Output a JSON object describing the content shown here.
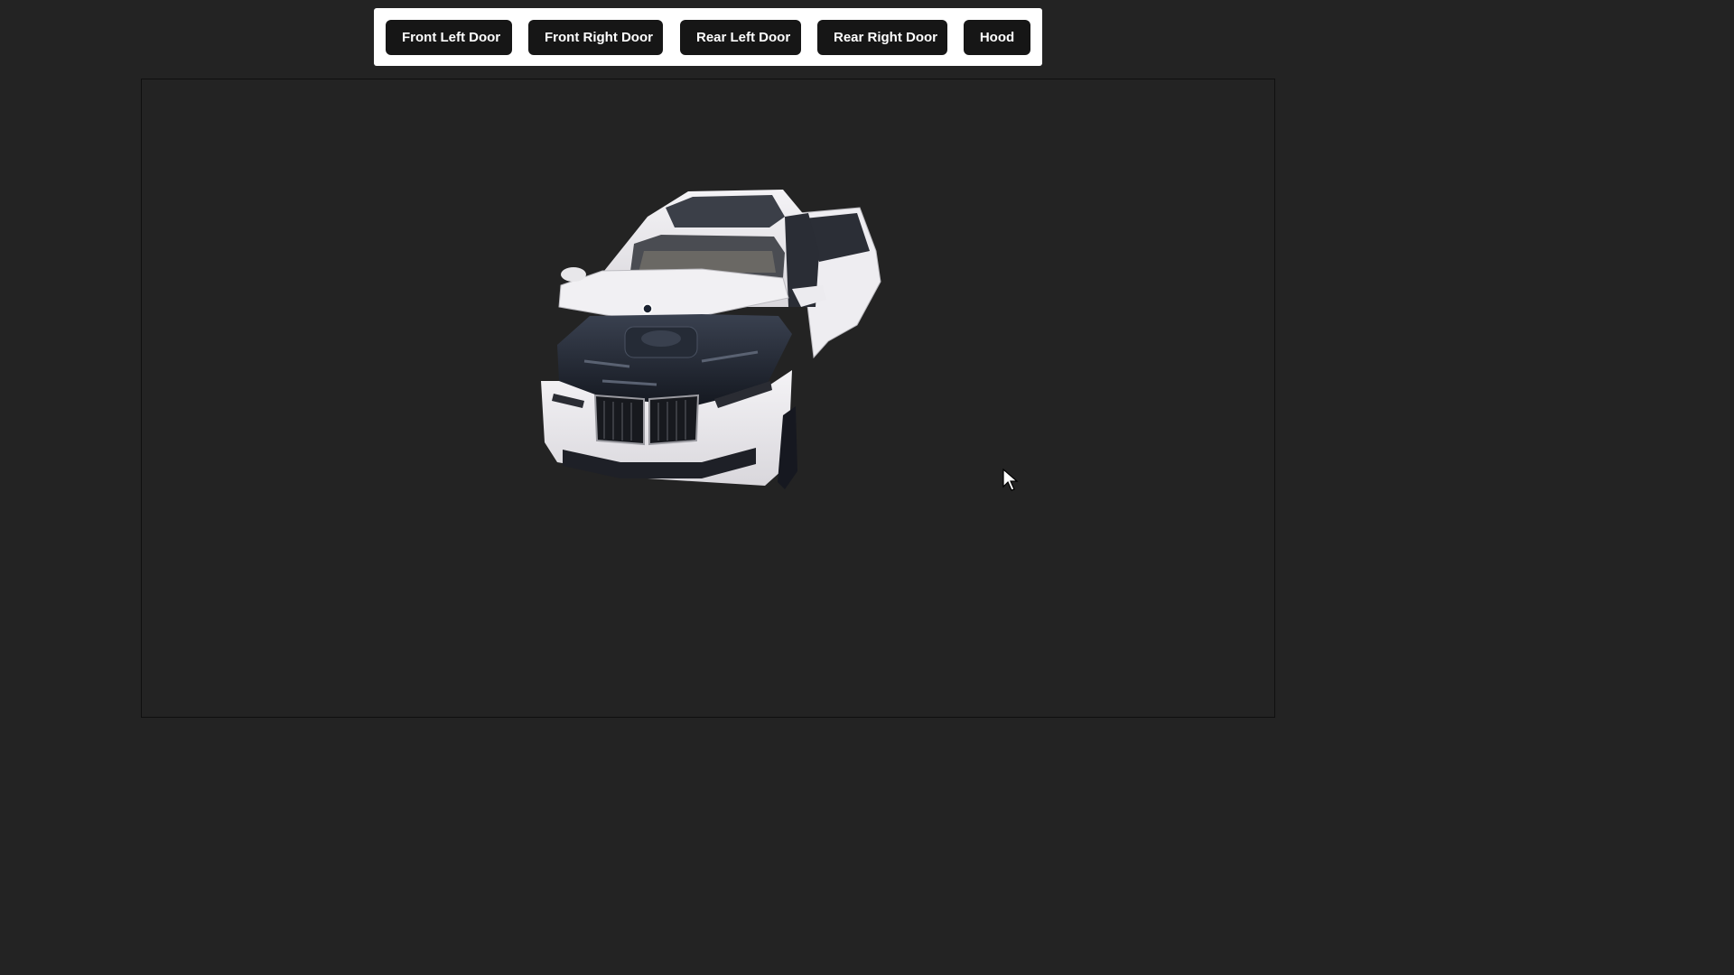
{
  "toolbar": {
    "buttons": [
      {
        "label": "Front Left Door"
      },
      {
        "label": "Front Right Door"
      },
      {
        "label": "Rear Left Door"
      },
      {
        "label": "Rear Right Door"
      },
      {
        "label": "Hood"
      }
    ]
  },
  "viewer": {
    "model_icon": "car-3d-model-icon",
    "background_color": "#232323"
  },
  "colors": {
    "button_bg": "#161616",
    "button_text": "#ffffff",
    "toolbar_bg": "#ffffff"
  }
}
